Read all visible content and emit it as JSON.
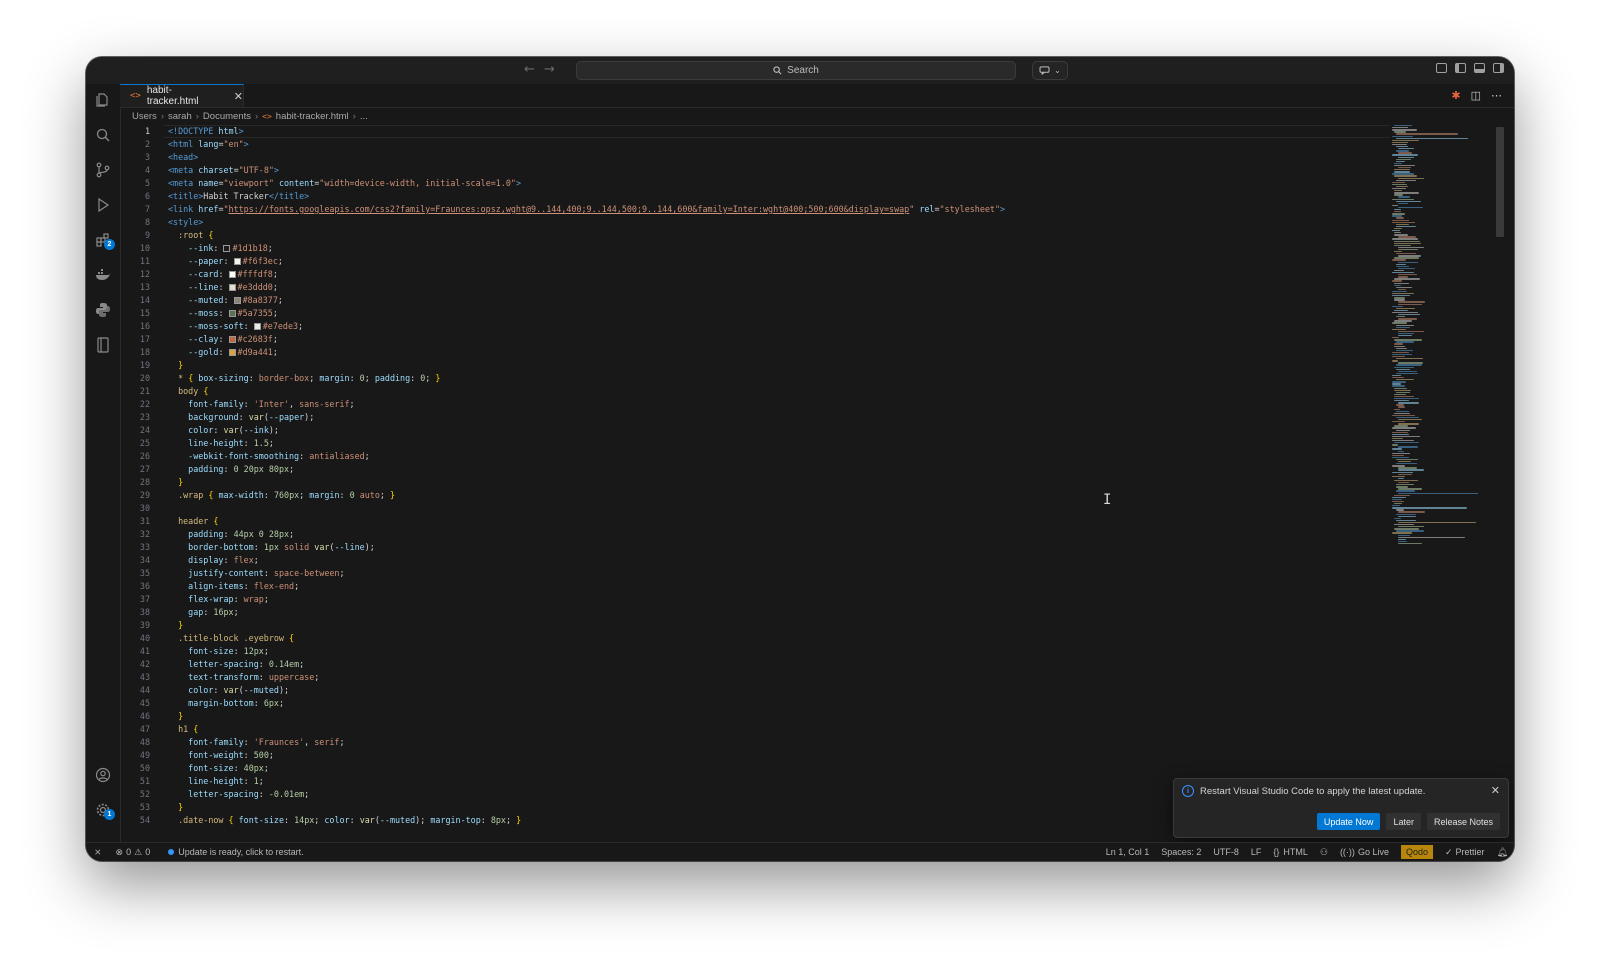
{
  "window": {
    "search_placeholder": "Search"
  },
  "tab": {
    "filename": "habit-tracker.html",
    "close": "✕"
  },
  "breadcrumb": [
    "Users",
    "sarah",
    "Documents",
    "habit-tracker.html",
    "..."
  ],
  "activity_badges": {
    "extensions": "2",
    "settings": "1"
  },
  "code_lines": [
    [
      [
        "t",
        "<!DOCTYPE "
      ],
      [
        "a",
        "html"
      ],
      [
        "t",
        ">"
      ]
    ],
    [
      [
        "t",
        "<html "
      ],
      [
        "a",
        "lang"
      ],
      [
        "x",
        "="
      ],
      [
        "s",
        "\"en\""
      ],
      [
        "t",
        ">"
      ]
    ],
    [
      [
        "t",
        "<head>"
      ]
    ],
    [
      [
        "t",
        "<meta "
      ],
      [
        "a",
        "charset"
      ],
      [
        "x",
        "="
      ],
      [
        "s",
        "\"UTF-8\""
      ],
      [
        "t",
        ">"
      ]
    ],
    [
      [
        "t",
        "<meta "
      ],
      [
        "a",
        "name"
      ],
      [
        "x",
        "="
      ],
      [
        "s",
        "\"viewport\""
      ],
      [
        "x",
        " "
      ],
      [
        "a",
        "content"
      ],
      [
        "x",
        "="
      ],
      [
        "s",
        "\"width=device-width, initial-scale=1.0\""
      ],
      [
        "t",
        ">"
      ]
    ],
    [
      [
        "t",
        "<title>"
      ],
      [
        "x",
        "Habit Tracker"
      ],
      [
        "t",
        "</title>"
      ]
    ],
    [
      [
        "t",
        "<link "
      ],
      [
        "a",
        "href"
      ],
      [
        "x",
        "="
      ],
      [
        "s",
        "\""
      ],
      [
        "l",
        "https://fonts.googleapis.com/css2?family=Fraunces:opsz,wght@9..144,400;9..144,500;9..144,600&family=Inter:wght@400;500;600&display=swap"
      ],
      [
        "s",
        "\""
      ],
      [
        "x",
        " "
      ],
      [
        "a",
        "rel"
      ],
      [
        "x",
        "="
      ],
      [
        "s",
        "\"stylesheet\""
      ],
      [
        "t",
        ">"
      ]
    ],
    [
      [
        "t",
        "<style>"
      ]
    ],
    [
      [
        "x",
        "  "
      ],
      [
        "e",
        ":root"
      ],
      [
        "x",
        " "
      ],
      [
        "b",
        "{"
      ]
    ],
    [
      [
        "x",
        "    "
      ],
      [
        "p",
        "--ink"
      ],
      [
        "x",
        ": "
      ],
      [
        "w",
        "#1d1b18"
      ],
      [
        "v",
        "#1d1b18"
      ],
      [
        "x",
        ";"
      ]
    ],
    [
      [
        "x",
        "    "
      ],
      [
        "p",
        "--paper"
      ],
      [
        "x",
        ": "
      ],
      [
        "w",
        "#f6f3ec"
      ],
      [
        "v",
        "#f6f3ec"
      ],
      [
        "x",
        ";"
      ]
    ],
    [
      [
        "x",
        "    "
      ],
      [
        "p",
        "--card"
      ],
      [
        "x",
        ": "
      ],
      [
        "w",
        "#fffdf8"
      ],
      [
        "v",
        "#fffdf8"
      ],
      [
        "x",
        ";"
      ]
    ],
    [
      [
        "x",
        "    "
      ],
      [
        "p",
        "--line"
      ],
      [
        "x",
        ": "
      ],
      [
        "w",
        "#e3ddd0"
      ],
      [
        "v",
        "#e3ddd0"
      ],
      [
        "x",
        ";"
      ]
    ],
    [
      [
        "x",
        "    "
      ],
      [
        "p",
        "--muted"
      ],
      [
        "x",
        ": "
      ],
      [
        "w",
        "#8a8377"
      ],
      [
        "v",
        "#8a8377"
      ],
      [
        "x",
        ";"
      ]
    ],
    [
      [
        "x",
        "    "
      ],
      [
        "p",
        "--moss"
      ],
      [
        "x",
        ": "
      ],
      [
        "w",
        "#5a7355"
      ],
      [
        "v",
        "#5a7355"
      ],
      [
        "x",
        ";"
      ]
    ],
    [
      [
        "x",
        "    "
      ],
      [
        "p",
        "--moss-soft"
      ],
      [
        "x",
        ": "
      ],
      [
        "w",
        "#e7ede3"
      ],
      [
        "v",
        "#e7ede3"
      ],
      [
        "x",
        ";"
      ]
    ],
    [
      [
        "x",
        "    "
      ],
      [
        "p",
        "--clay"
      ],
      [
        "x",
        ": "
      ],
      [
        "w",
        "#c2683f"
      ],
      [
        "v",
        "#c2683f"
      ],
      [
        "x",
        ";"
      ]
    ],
    [
      [
        "x",
        "    "
      ],
      [
        "p",
        "--gold"
      ],
      [
        "x",
        ": "
      ],
      [
        "w",
        "#d9a441"
      ],
      [
        "v",
        "#d9a441"
      ],
      [
        "x",
        ";"
      ]
    ],
    [
      [
        "x",
        "  "
      ],
      [
        "b",
        "}"
      ]
    ],
    [
      [
        "x",
        "  "
      ],
      [
        "e",
        "*"
      ],
      [
        "x",
        " "
      ],
      [
        "b",
        "{"
      ],
      [
        "x",
        " "
      ],
      [
        "p",
        "box-sizing"
      ],
      [
        "x",
        ": "
      ],
      [
        "v",
        "border-box"
      ],
      [
        "x",
        "; "
      ],
      [
        "p",
        "margin"
      ],
      [
        "x",
        ": "
      ],
      [
        "n",
        "0"
      ],
      [
        "x",
        "; "
      ],
      [
        "p",
        "padding"
      ],
      [
        "x",
        ": "
      ],
      [
        "n",
        "0"
      ],
      [
        "x",
        "; "
      ],
      [
        "b",
        "}"
      ]
    ],
    [
      [
        "x",
        "  "
      ],
      [
        "e",
        "body"
      ],
      [
        "x",
        " "
      ],
      [
        "b",
        "{"
      ]
    ],
    [
      [
        "x",
        "    "
      ],
      [
        "p",
        "font-family"
      ],
      [
        "x",
        ": "
      ],
      [
        "v",
        "'Inter'"
      ],
      [
        "x",
        ", "
      ],
      [
        "v",
        "sans-serif"
      ],
      [
        "x",
        ";"
      ]
    ],
    [
      [
        "x",
        "    "
      ],
      [
        "p",
        "background"
      ],
      [
        "x",
        ": "
      ],
      [
        "f",
        "var"
      ],
      [
        "x",
        "("
      ],
      [
        "p",
        "--paper"
      ],
      [
        "x",
        ");"
      ]
    ],
    [
      [
        "x",
        "    "
      ],
      [
        "p",
        "color"
      ],
      [
        "x",
        ": "
      ],
      [
        "f",
        "var"
      ],
      [
        "x",
        "("
      ],
      [
        "p",
        "--ink"
      ],
      [
        "x",
        ");"
      ]
    ],
    [
      [
        "x",
        "    "
      ],
      [
        "p",
        "line-height"
      ],
      [
        "x",
        ": "
      ],
      [
        "n",
        "1.5"
      ],
      [
        "x",
        ";"
      ]
    ],
    [
      [
        "x",
        "    "
      ],
      [
        "p",
        "-webkit-font-smoothing"
      ],
      [
        "x",
        ": "
      ],
      [
        "v",
        "antialiased"
      ],
      [
        "x",
        ";"
      ]
    ],
    [
      [
        "x",
        "    "
      ],
      [
        "p",
        "padding"
      ],
      [
        "x",
        ": "
      ],
      [
        "n",
        "0 20px 80px"
      ],
      [
        "x",
        ";"
      ]
    ],
    [
      [
        "x",
        "  "
      ],
      [
        "b",
        "}"
      ]
    ],
    [
      [
        "x",
        "  "
      ],
      [
        "e",
        ".wrap"
      ],
      [
        "x",
        " "
      ],
      [
        "b",
        "{"
      ],
      [
        "x",
        " "
      ],
      [
        "p",
        "max-width"
      ],
      [
        "x",
        ": "
      ],
      [
        "n",
        "760px"
      ],
      [
        "x",
        "; "
      ],
      [
        "p",
        "margin"
      ],
      [
        "x",
        ": "
      ],
      [
        "n",
        "0"
      ],
      [
        "x",
        " "
      ],
      [
        "v",
        "auto"
      ],
      [
        "x",
        "; "
      ],
      [
        "b",
        "}"
      ]
    ],
    [
      [
        "x",
        ""
      ]
    ],
    [
      [
        "x",
        "  "
      ],
      [
        "e",
        "header"
      ],
      [
        "x",
        " "
      ],
      [
        "b",
        "{"
      ]
    ],
    [
      [
        "x",
        "    "
      ],
      [
        "p",
        "padding"
      ],
      [
        "x",
        ": "
      ],
      [
        "n",
        "44px 0 28px"
      ],
      [
        "x",
        ";"
      ]
    ],
    [
      [
        "x",
        "    "
      ],
      [
        "p",
        "border-bottom"
      ],
      [
        "x",
        ": "
      ],
      [
        "n",
        "1px"
      ],
      [
        "x",
        " "
      ],
      [
        "v",
        "solid"
      ],
      [
        "x",
        " "
      ],
      [
        "f",
        "var"
      ],
      [
        "x",
        "("
      ],
      [
        "p",
        "--line"
      ],
      [
        "x",
        ");"
      ]
    ],
    [
      [
        "x",
        "    "
      ],
      [
        "p",
        "display"
      ],
      [
        "x",
        ": "
      ],
      [
        "v",
        "flex"
      ],
      [
        "x",
        ";"
      ]
    ],
    [
      [
        "x",
        "    "
      ],
      [
        "p",
        "justify-content"
      ],
      [
        "x",
        ": "
      ],
      [
        "v",
        "space-between"
      ],
      [
        "x",
        ";"
      ]
    ],
    [
      [
        "x",
        "    "
      ],
      [
        "p",
        "align-items"
      ],
      [
        "x",
        ": "
      ],
      [
        "v",
        "flex-end"
      ],
      [
        "x",
        ";"
      ]
    ],
    [
      [
        "x",
        "    "
      ],
      [
        "p",
        "flex-wrap"
      ],
      [
        "x",
        ": "
      ],
      [
        "v",
        "wrap"
      ],
      [
        "x",
        ";"
      ]
    ],
    [
      [
        "x",
        "    "
      ],
      [
        "p",
        "gap"
      ],
      [
        "x",
        ": "
      ],
      [
        "n",
        "16px"
      ],
      [
        "x",
        ";"
      ]
    ],
    [
      [
        "x",
        "  "
      ],
      [
        "b",
        "}"
      ]
    ],
    [
      [
        "x",
        "  "
      ],
      [
        "e",
        ".title-block .eyebrow"
      ],
      [
        "x",
        " "
      ],
      [
        "b",
        "{"
      ]
    ],
    [
      [
        "x",
        "    "
      ],
      [
        "p",
        "font-size"
      ],
      [
        "x",
        ": "
      ],
      [
        "n",
        "12px"
      ],
      [
        "x",
        ";"
      ]
    ],
    [
      [
        "x",
        "    "
      ],
      [
        "p",
        "letter-spacing"
      ],
      [
        "x",
        ": "
      ],
      [
        "n",
        "0.14em"
      ],
      [
        "x",
        ";"
      ]
    ],
    [
      [
        "x",
        "    "
      ],
      [
        "p",
        "text-transform"
      ],
      [
        "x",
        ": "
      ],
      [
        "v",
        "uppercase"
      ],
      [
        "x",
        ";"
      ]
    ],
    [
      [
        "x",
        "    "
      ],
      [
        "p",
        "color"
      ],
      [
        "x",
        ": "
      ],
      [
        "f",
        "var"
      ],
      [
        "x",
        "("
      ],
      [
        "p",
        "--muted"
      ],
      [
        "x",
        ");"
      ]
    ],
    [
      [
        "x",
        "    "
      ],
      [
        "p",
        "margin-bottom"
      ],
      [
        "x",
        ": "
      ],
      [
        "n",
        "6px"
      ],
      [
        "x",
        ";"
      ]
    ],
    [
      [
        "x",
        "  "
      ],
      [
        "b",
        "}"
      ]
    ],
    [
      [
        "x",
        "  "
      ],
      [
        "e",
        "h1"
      ],
      [
        "x",
        " "
      ],
      [
        "b",
        "{"
      ]
    ],
    [
      [
        "x",
        "    "
      ],
      [
        "p",
        "font-family"
      ],
      [
        "x",
        ": "
      ],
      [
        "v",
        "'Fraunces'"
      ],
      [
        "x",
        ", "
      ],
      [
        "v",
        "serif"
      ],
      [
        "x",
        ";"
      ]
    ],
    [
      [
        "x",
        "    "
      ],
      [
        "p",
        "font-weight"
      ],
      [
        "x",
        ": "
      ],
      [
        "n",
        "500"
      ],
      [
        "x",
        ";"
      ]
    ],
    [
      [
        "x",
        "    "
      ],
      [
        "p",
        "font-size"
      ],
      [
        "x",
        ": "
      ],
      [
        "n",
        "40px"
      ],
      [
        "x",
        ";"
      ]
    ],
    [
      [
        "x",
        "    "
      ],
      [
        "p",
        "line-height"
      ],
      [
        "x",
        ": "
      ],
      [
        "n",
        "1"
      ],
      [
        "x",
        ";"
      ]
    ],
    [
      [
        "x",
        "    "
      ],
      [
        "p",
        "letter-spacing"
      ],
      [
        "x",
        ": "
      ],
      [
        "n",
        "-0.01em"
      ],
      [
        "x",
        ";"
      ]
    ],
    [
      [
        "x",
        "  "
      ],
      [
        "b",
        "}"
      ]
    ],
    [
      [
        "x",
        "  "
      ],
      [
        "e",
        ".date-now"
      ],
      [
        "x",
        " "
      ],
      [
        "b",
        "{"
      ],
      [
        "x",
        " "
      ],
      [
        "p",
        "font-size"
      ],
      [
        "x",
        ": "
      ],
      [
        "n",
        "14px"
      ],
      [
        "x",
        "; "
      ],
      [
        "p",
        "color"
      ],
      [
        "x",
        ": "
      ],
      [
        "f",
        "var"
      ],
      [
        "x",
        "("
      ],
      [
        "p",
        "--muted"
      ],
      [
        "x",
        "); "
      ],
      [
        "p",
        "margin-top"
      ],
      [
        "x",
        ": "
      ],
      [
        "n",
        "8px"
      ],
      [
        "x",
        "; "
      ],
      [
        "b",
        "}"
      ]
    ]
  ],
  "notification": {
    "message": "Restart Visual Studio Code to apply the latest update.",
    "update_now": "Update Now",
    "later": "Later",
    "release_notes": "Release Notes",
    "close": "✕"
  },
  "statusbar": {
    "errors": "0",
    "warnings": "0",
    "update_msg": "Update is ready, click to restart.",
    "position": "Ln 1, Col 1",
    "spaces": "Spaces: 2",
    "encoding": "UTF-8",
    "eol": "LF",
    "language": "HTML",
    "golive": "Go Live",
    "qodo": "Qodo",
    "prettier": "Prettier"
  },
  "colors": {
    "accent": "#0078d4",
    "editor_bg": "#181818",
    "qodo": "#b8860b"
  }
}
